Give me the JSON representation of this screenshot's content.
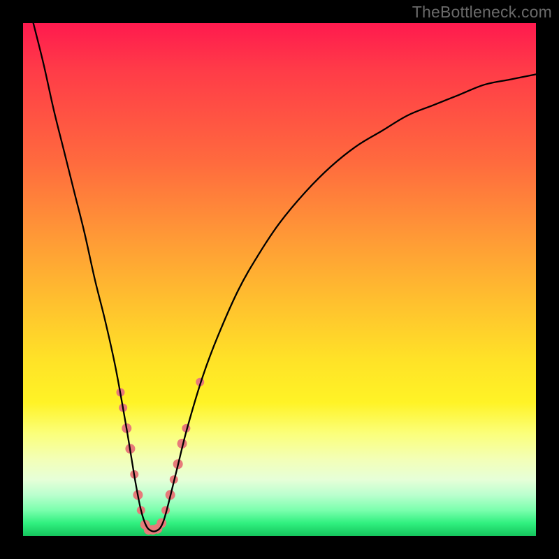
{
  "watermark": "TheBottleneck.com",
  "chart_data": {
    "type": "line",
    "title": "",
    "xlabel": "",
    "ylabel": "",
    "xlim": [
      0,
      100
    ],
    "ylim": [
      0,
      100
    ],
    "series": [
      {
        "name": "bottleneck-curve",
        "color": "#000000",
        "x": [
          2,
          4,
          6,
          8,
          10,
          12,
          14,
          16,
          18,
          20,
          21,
          22,
          23,
          24,
          25,
          26,
          27,
          28,
          30,
          32,
          35,
          38,
          42,
          46,
          50,
          55,
          60,
          65,
          70,
          75,
          80,
          85,
          90,
          95,
          100
        ],
        "values": [
          100,
          92,
          83,
          75,
          67,
          59,
          50,
          42,
          33,
          22,
          16,
          10,
          5,
          2,
          1,
          1,
          2,
          5,
          13,
          21,
          31,
          39,
          48,
          55,
          61,
          67,
          72,
          76,
          79,
          82,
          84,
          86,
          88,
          89,
          90
        ]
      }
    ],
    "markers": {
      "name": "highlighted-points",
      "color": "#e77a7a",
      "points": [
        {
          "x": 19.0,
          "y": 28,
          "r": 6
        },
        {
          "x": 19.5,
          "y": 25,
          "r": 6
        },
        {
          "x": 20.2,
          "y": 21,
          "r": 7
        },
        {
          "x": 20.9,
          "y": 17,
          "r": 7
        },
        {
          "x": 21.7,
          "y": 12,
          "r": 6
        },
        {
          "x": 22.4,
          "y": 8,
          "r": 7
        },
        {
          "x": 23.0,
          "y": 5,
          "r": 6
        },
        {
          "x": 23.8,
          "y": 2.2,
          "r": 7
        },
        {
          "x": 24.5,
          "y": 1.2,
          "r": 7
        },
        {
          "x": 25.3,
          "y": 1.2,
          "r": 7
        },
        {
          "x": 26.2,
          "y": 1.4,
          "r": 7
        },
        {
          "x": 27.0,
          "y": 2.5,
          "r": 7
        },
        {
          "x": 27.8,
          "y": 5,
          "r": 6
        },
        {
          "x": 28.7,
          "y": 8,
          "r": 7
        },
        {
          "x": 29.4,
          "y": 11,
          "r": 6
        },
        {
          "x": 30.2,
          "y": 14,
          "r": 7
        },
        {
          "x": 31.0,
          "y": 18,
          "r": 7
        },
        {
          "x": 31.8,
          "y": 21,
          "r": 6
        },
        {
          "x": 34.5,
          "y": 30,
          "r": 6
        }
      ]
    }
  }
}
